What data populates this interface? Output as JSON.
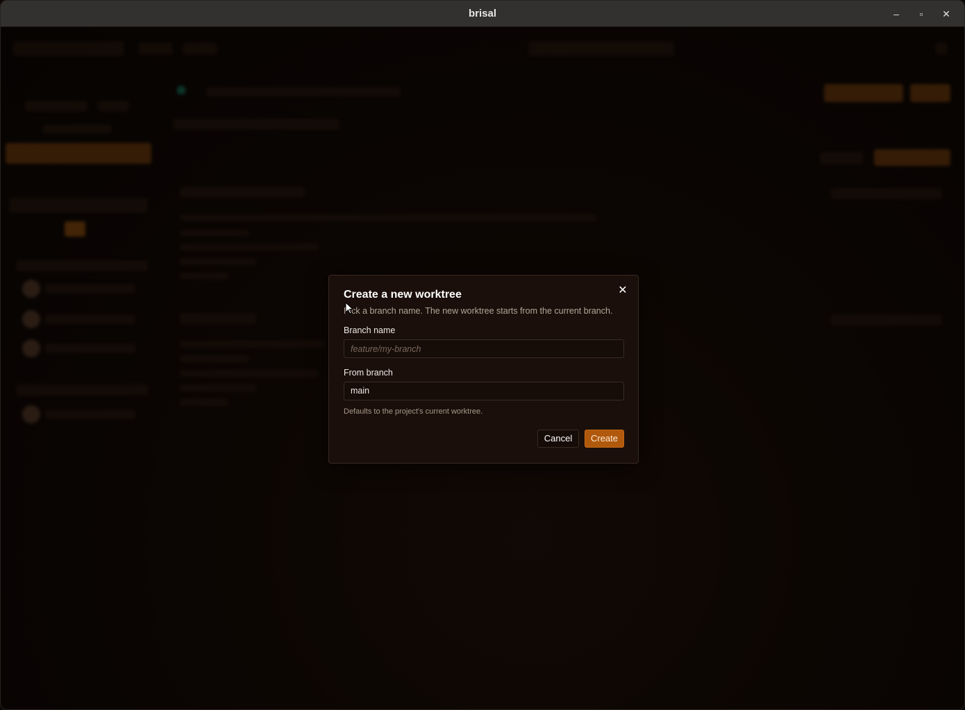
{
  "window": {
    "title": "brisal",
    "controls": {
      "minimize": "–",
      "maximize": "▫",
      "close": "✕"
    }
  },
  "dialog": {
    "title": "Create a new worktree",
    "subtitle": "Pick a branch name. The new worktree starts from the current branch.",
    "branch_name": {
      "label": "Branch name",
      "placeholder": "feature/my-branch",
      "value": ""
    },
    "from_branch": {
      "label": "From branch",
      "value": "main",
      "hint": "Defaults to the project's current worktree."
    },
    "buttons": {
      "cancel": "Cancel",
      "create": "Create"
    },
    "close_icon": "close-icon"
  },
  "colors": {
    "accent": "#b0590c",
    "dialog_bg": "#1a0f0a",
    "titlebar": "#33312f"
  }
}
